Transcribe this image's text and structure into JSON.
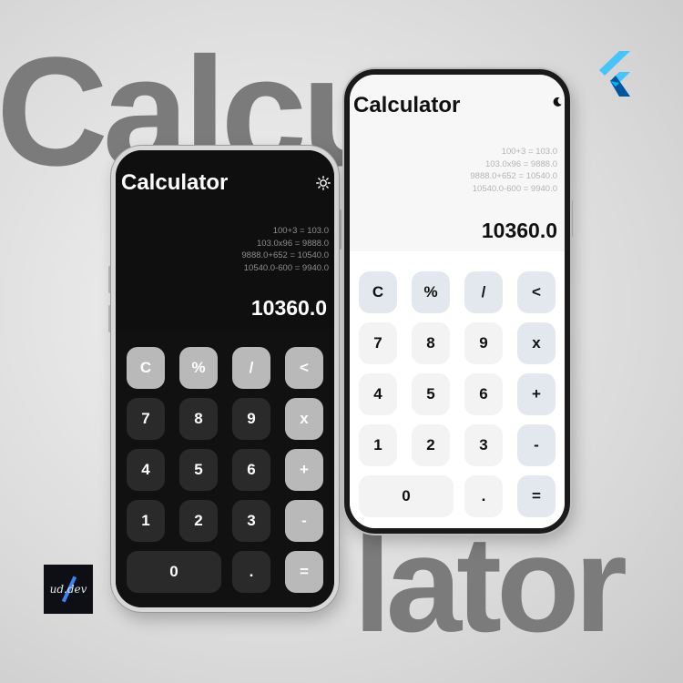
{
  "background": {
    "word_top": "Calcu",
    "word_bottom": "lator"
  },
  "logos": {
    "flutter": "flutter-logo-icon",
    "ud_dev": "ud.dev"
  },
  "colors": {
    "dark_bg": "#0f0f0f",
    "dark_function_key": "#b9b9b9",
    "dark_number_key": "#2a2a2a",
    "light_function_key": "#e3e8ee",
    "flutter_blue": "#47c5fb"
  },
  "dark_phone": {
    "title": "Calculator",
    "theme_icon": "sun-icon",
    "history": [
      "100+3 = 103.0",
      "103.0x96 = 9888.0",
      "9888.0+652 = 10540.0",
      "10540.0-600 = 9940.0"
    ],
    "result": "10360.0",
    "keys": {
      "clear": "C",
      "percent": "%",
      "divide": "/",
      "backspace": "<",
      "seven": "7",
      "eight": "8",
      "nine": "9",
      "multiply": "x",
      "four": "4",
      "five": "5",
      "six": "6",
      "plus": "+",
      "one": "1",
      "two": "2",
      "three": "3",
      "minus": "-",
      "zero": "0",
      "dot": ".",
      "equals": "="
    }
  },
  "light_phone": {
    "title": "Calculator",
    "theme_icon": "moon-icon",
    "history": [
      "100+3 = 103.0",
      "103.0x96 = 9888.0",
      "9888.0+652 = 10540.0",
      "10540.0-600 = 9940.0"
    ],
    "result": "10360.0",
    "keys": {
      "clear": "C",
      "percent": "%",
      "divide": "/",
      "backspace": "<",
      "seven": "7",
      "eight": "8",
      "nine": "9",
      "multiply": "x",
      "four": "4",
      "five": "5",
      "six": "6",
      "plus": "+",
      "one": "1",
      "two": "2",
      "three": "3",
      "minus": "-",
      "zero": "0",
      "dot": ".",
      "equals": "="
    }
  }
}
